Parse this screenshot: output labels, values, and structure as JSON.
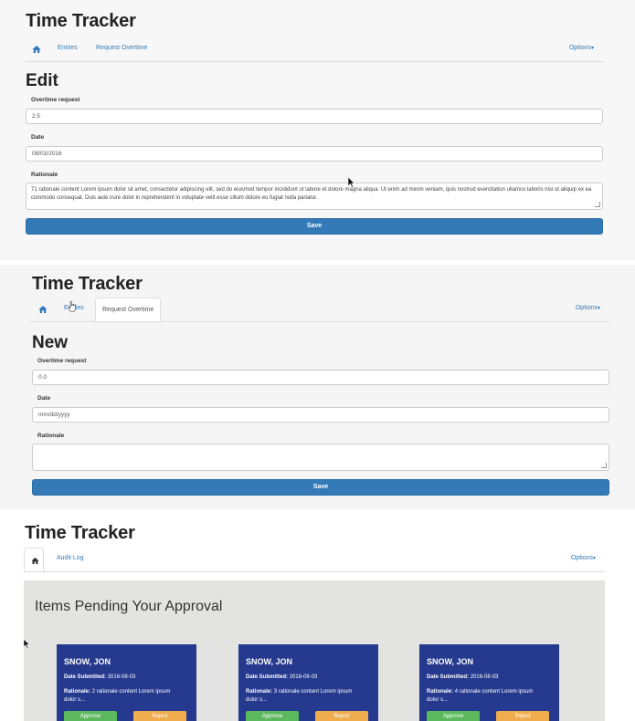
{
  "panel_edit": {
    "app_title": "Time Tracker",
    "nav": {
      "entries": "Entries",
      "request_overtime": "Request Overtime",
      "options": "Options"
    },
    "heading": "Edit",
    "overtime_label": "Overtime request",
    "overtime_value": "2.5",
    "date_label": "Date",
    "date_value": "08/03/2016",
    "rationale_label": "Rationale",
    "rationale_value": "71 rationale content Lorem ipsum dolor sit amet, consectetur adipiscing elit, sed do eiusmod tempor incididunt ut labore et dolore magna aliqua. Ut enim ad minim veniam, quis nostrud exercitation ullamco laboris nisi ut aliquip ex ea commodo consequat. Duis aute irure dolor in reprehenderit in voluptate velit esse cillum dolore eu fugiat nulla pariatur.",
    "save_label": "Save"
  },
  "panel_new": {
    "app_title": "Time Tracker",
    "nav": {
      "entries": "Entries",
      "request_overtime": "Request Overtime",
      "options": "Options"
    },
    "heading": "New",
    "overtime_label": "Overtime request",
    "overtime_value": "0.0",
    "date_label": "Date",
    "date_placeholder": "mm/dd/yyyy",
    "rationale_label": "Rationale",
    "rationale_value": "",
    "save_label": "Save"
  },
  "panel_approval": {
    "app_title": "Time Tracker",
    "nav": {
      "audit_log": "Audit Log",
      "options": "Options"
    },
    "section_title": "Items Pending Your Approval",
    "cards": [
      {
        "name": "SNOW, JON",
        "date_label": "Date Submitted:",
        "date_value": "2016-08-03",
        "rationale_label": "Rationale:",
        "rationale_value": "2 rationale content Lorem ipsum dolor s...",
        "approve_label": "Approve",
        "reject_label": "Reject"
      },
      {
        "name": "SNOW, JON",
        "date_label": "Date Submitted:",
        "date_value": "2016-08-03",
        "rationale_label": "Rationale:",
        "rationale_value": "3 rationale content Lorem ipsum dolor s...",
        "approve_label": "Approve",
        "reject_label": "Reject"
      },
      {
        "name": "SNOW, JON",
        "date_label": "Date Submitted:",
        "date_value": "2016-08-03",
        "rationale_label": "Rationale:",
        "rationale_value": "4 rationale content Lorem ipsum dolor s...",
        "approve_label": "Approve",
        "reject_label": "Reject"
      }
    ]
  },
  "colors": {
    "primary": "#337ab7",
    "card_bg": "#253a8f",
    "approve": "#5cb85c",
    "reject": "#f0ad4e",
    "pending_bg": "#e3e3e1"
  },
  "icons": {
    "home": "home-icon",
    "caret": "caret-down-icon",
    "cursor": "mouse-pointer-icon"
  }
}
